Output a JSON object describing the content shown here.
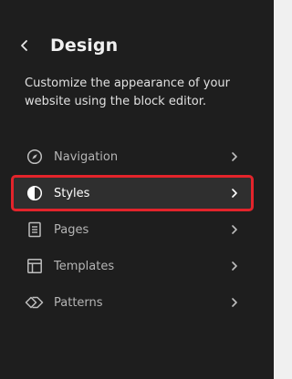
{
  "header": {
    "title": "Design"
  },
  "description": "Customize the appearance of your website using the block editor.",
  "nav": {
    "items": [
      {
        "label": "Navigation",
        "icon": "navigation-compass-icon",
        "selected": false
      },
      {
        "label": "Styles",
        "icon": "styles-half-circle-icon",
        "selected": true
      },
      {
        "label": "Pages",
        "icon": "pages-document-icon",
        "selected": false
      },
      {
        "label": "Templates",
        "icon": "templates-layout-icon",
        "selected": false
      },
      {
        "label": "Patterns",
        "icon": "patterns-diamonds-icon",
        "selected": false
      }
    ]
  },
  "colors": {
    "sidebar_bg": "#1e1e1e",
    "highlight": "#e3242b"
  }
}
